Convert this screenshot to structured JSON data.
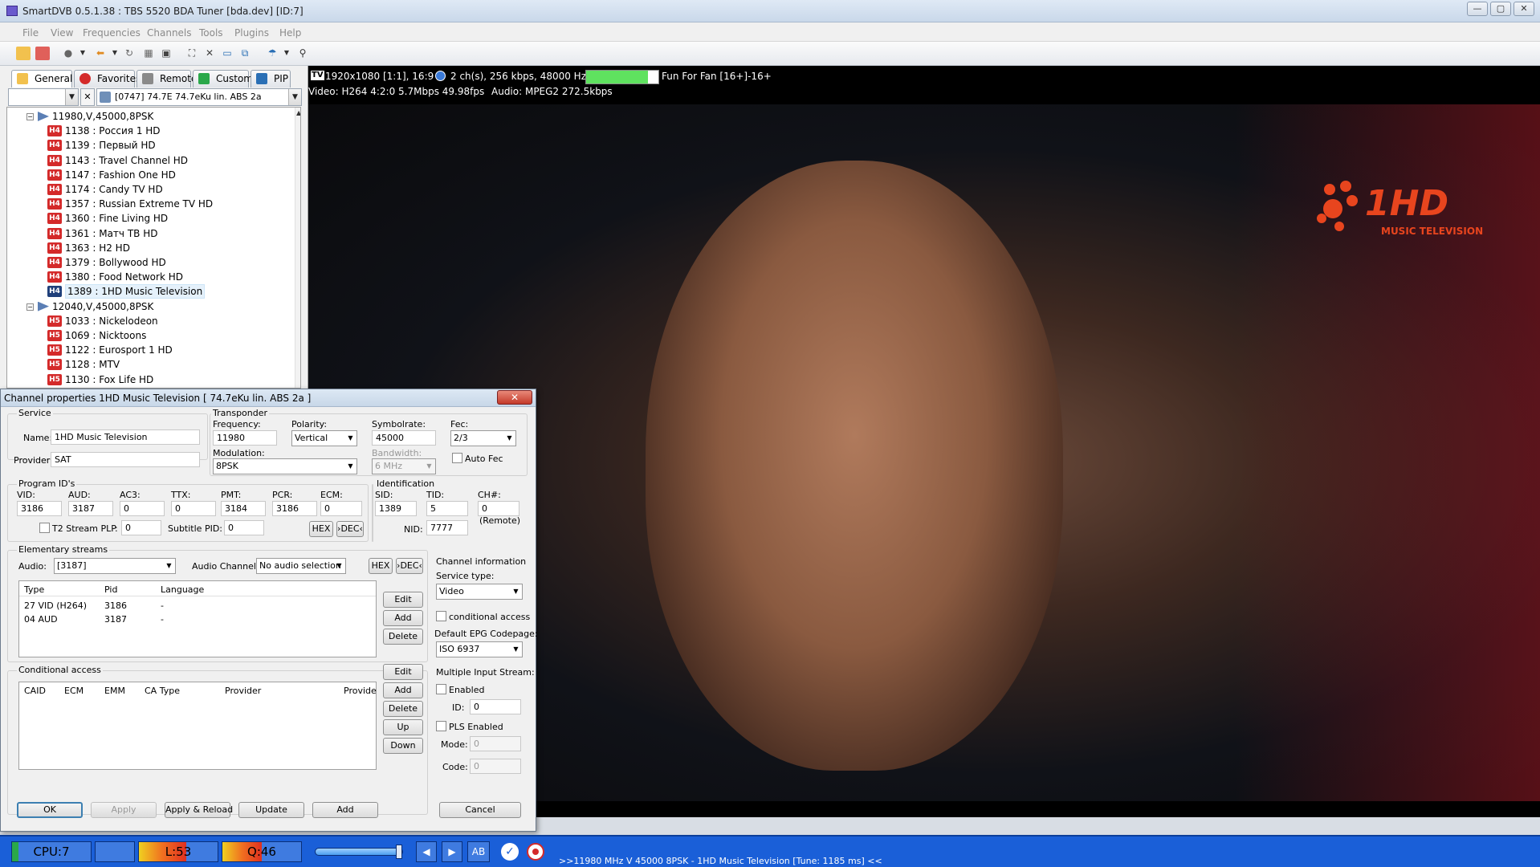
{
  "window": {
    "title": "SmartDVB 0.5.1.38 : TBS 5520 BDA Tuner [bda.dev]  [ID:7]"
  },
  "menu": [
    "File",
    "View",
    "Frequencies",
    "Channels",
    "Tools",
    "Plugins",
    "Help"
  ],
  "tabs": [
    "General",
    "Favorites",
    "Remote",
    "Custom",
    "PIP"
  ],
  "satellite_combo": "[0747] 74.7E  74.7eKu lin. ABS 2a",
  "tree": {
    "transponder1": "11980,V,45000,8PSK",
    "group1": [
      {
        "badge": "H4",
        "label": "1138 : Россия 1 HD"
      },
      {
        "badge": "H4",
        "label": "1139 : Первый HD"
      },
      {
        "badge": "H4",
        "label": "1143 : Travel Channel HD"
      },
      {
        "badge": "H4",
        "label": "1147 : Fashion One HD"
      },
      {
        "badge": "H4",
        "label": "1174 : Candy TV HD"
      },
      {
        "badge": "H4",
        "label": "1357 : Russian Extreme TV HD"
      },
      {
        "badge": "H4",
        "label": "1360 : Fine Living HD"
      },
      {
        "badge": "H4",
        "label": "1361 : Матч ТВ HD"
      },
      {
        "badge": "H4",
        "label": "1363 : H2 HD"
      },
      {
        "badge": "H4",
        "label": "1379 : Bollywood HD"
      },
      {
        "badge": "H4",
        "label": "1380 : Food Network HD"
      },
      {
        "badge": "H4",
        "label": "1389 : 1HD Music Television"
      }
    ],
    "transponder2": "12040,V,45000,8PSK",
    "group2": [
      {
        "badge": "H5",
        "label": "1033 : Nickelodeon"
      },
      {
        "badge": "H5",
        "label": "1069 : Nicktoons"
      },
      {
        "badge": "H5",
        "label": "1122 : Eurosport 1 HD"
      },
      {
        "badge": "H5",
        "label": "1128 : MTV"
      },
      {
        "badge": "H5",
        "label": "1130 : Fox Life HD"
      }
    ]
  },
  "video_info": {
    "tv_badge": "TV",
    "resolution": "1920x1080 [1:1], 16:9",
    "audio": "2 ch(s), 256 kbps, 48000 Hz",
    "signal_level": 0.85,
    "program": "Fun For Fan [16+]-16+",
    "video_line": "Video: H264  4:2:0  5.7Mbps  49.98fps",
    "audio_line": "Audio: MPEG2  272.5kbps"
  },
  "logo": {
    "main": "1HD",
    "sub": "MUSIC TELEVISION"
  },
  "dialog": {
    "title": "Channel properties 1HD Music Television [ 74.7eKu lin. ABS 2a ]",
    "close": "✕",
    "service": {
      "group": "Service",
      "name_label": "Name:",
      "name": "1HD Music Television",
      "provider_label": "Provider:",
      "provider": "SAT"
    },
    "transponder": {
      "group": "Transponder",
      "freq_label": "Frequency:",
      "freq": "11980",
      "pol_label": "Polarity:",
      "pol": "Vertical",
      "sym_label": "Symbolrate:",
      "sym": "45000",
      "fec_label": "Fec:",
      "fec": "2/3",
      "mod_label": "Modulation:",
      "mod": "8PSK",
      "bw_label": "Bandwidth:",
      "bw": "6 MHz",
      "autofec": "Auto Fec"
    },
    "pids": {
      "group": "Program ID's",
      "vid_label": "VID:",
      "vid": "3186",
      "aud_label": "AUD:",
      "aud": "3187",
      "ac3_label": "AC3:",
      "ac3": "0",
      "ttx_label": "TTX:",
      "ttx": "0",
      "pmt_label": "PMT:",
      "pmt": "3184",
      "pcr_label": "PCR:",
      "pcr": "3186",
      "ecm_label": "ECM:",
      "ecm": "0",
      "t2_label": "T2 Stream PLP",
      "colon": ":",
      "t2": "0",
      "sub_label": "Subtitle PID:",
      "sub": "0",
      "hex": "HEX",
      "dec": "›DEC‹"
    },
    "ident": {
      "group": "Identification",
      "sid_label": "SID:",
      "sid": "1389",
      "tid_label": "TID:",
      "tid": "5",
      "ch_label": "CH#:",
      "ch": "0",
      "nid_label": "NID:",
      "nid": "7777",
      "remote": "(Remote)"
    },
    "es": {
      "group": "Elementary streams",
      "audio_label": "Audio:",
      "audio": "[3187]",
      "ach_label": "Audio Channel:",
      "ach": "No audio selection",
      "hex": "HEX",
      "dec": "›DEC‹",
      "cols": [
        "Type",
        "Pid",
        "Language"
      ],
      "rows": [
        {
          "type": "27 VID (H264)",
          "pid": "3186",
          "lang": "-"
        },
        {
          "type": "04 AUD",
          "pid": "3187",
          "lang": "-"
        }
      ],
      "edit": "Edit",
      "add": "Add",
      "delete": "Delete"
    },
    "ca": {
      "group": "Conditional access",
      "cols": [
        "CAID",
        "ECM",
        "EMM",
        "CA Type",
        "Provider",
        "Provide"
      ],
      "edit": "Edit",
      "add": "Add",
      "delete": "Delete",
      "up": "Up",
      "down": "Down"
    },
    "chinfo": {
      "group": "Channel information",
      "stype_label": "Service type:",
      "stype": "Video",
      "ca_label": "conditional access",
      "epg_label": "Default EPG Codepage:",
      "epg": "ISO 6937",
      "mis_label": "Multiple Input Stream:",
      "enabled": "Enabled",
      "id_label": "ID:",
      "id": "0",
      "pls": "PLS Enabled",
      "mode_label": "Mode:",
      "mode": "0",
      "code_label": "Code:",
      "code": "0"
    },
    "buttons": {
      "ok": "OK",
      "apply": "Apply",
      "apply_reload": "Apply & Reload",
      "update": "Update",
      "add": "Add",
      "cancel": "Cancel"
    }
  },
  "status": {
    "cpu": "CPU:7",
    "level": "L:53",
    "quality": "Q:46",
    "ab": "AB",
    "text": ">>11980 MHz V 45000 8PSK - 1HD Music Television [Tune: 1185 ms] <<"
  },
  "colors": {
    "accent": "#1a5fd8",
    "h4": "#d42a2a",
    "h4_selected": "#1f3f7a",
    "h5": "#d42a2a",
    "signal": "#5fe25f"
  }
}
